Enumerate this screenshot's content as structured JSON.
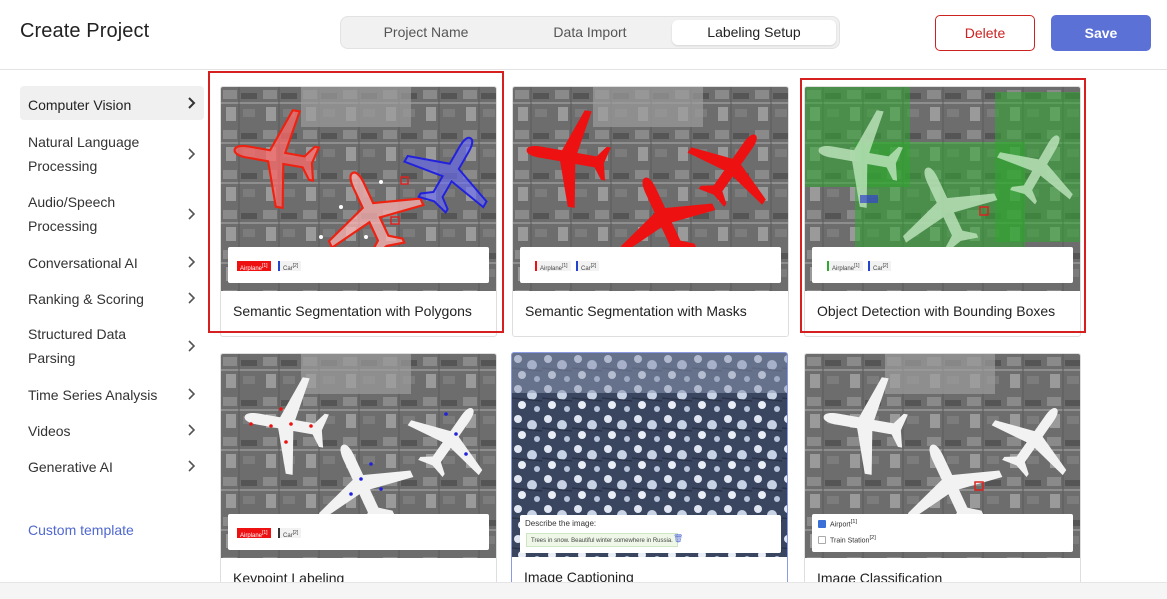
{
  "header": {
    "title": "Create Project",
    "steps": [
      "Project Name",
      "Data Import",
      "Labeling Setup"
    ],
    "active_step": "Labeling Setup",
    "delete_label": "Delete",
    "save_label": "Save"
  },
  "sidebar": {
    "items": [
      {
        "label": "Computer Vision",
        "active": true
      },
      {
        "label": "Natural Language Processing"
      },
      {
        "label": "Audio/Speech Processing"
      },
      {
        "label": "Conversational AI"
      },
      {
        "label": "Ranking & Scoring"
      },
      {
        "label": "Structured Data Parsing"
      },
      {
        "label": "Time Series Analysis"
      },
      {
        "label": "Videos"
      },
      {
        "label": "Generative AI"
      }
    ],
    "custom_template": "Custom template"
  },
  "templates": [
    {
      "label": "Semantic Segmentation with Polygons",
      "legend": [
        "Airplane",
        "Car"
      ]
    },
    {
      "label": "Semantic Segmentation with Masks",
      "legend": [
        "Airplane",
        "Car"
      ]
    },
    {
      "label": "Object Detection with Bounding Boxes",
      "legend": [
        "Airplane",
        "Car"
      ]
    },
    {
      "label": "Keypoint Labeling",
      "legend": [
        "Airplane",
        "Car"
      ]
    },
    {
      "label": "Image Captioning",
      "prompt": "Describe the image:",
      "caption": "Trees in snow. Beautiful winter somewhere in Russia."
    },
    {
      "label": "Image Classification",
      "choices": [
        "Airport",
        "Train Station"
      ]
    }
  ],
  "legend_hotkeys": [
    "[1]",
    "[2]"
  ],
  "colors": {
    "accent": "#5b71d6",
    "danger": "#cc2222",
    "highlight": "#d62020",
    "airplane": "#ee1111",
    "car": "#2244cc",
    "box_green": "#2fa82f"
  }
}
